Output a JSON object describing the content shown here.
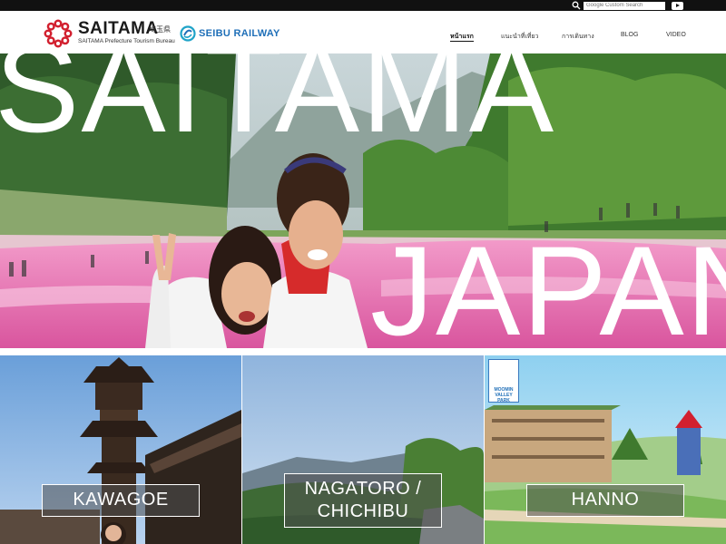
{
  "utility": {
    "search_placeholder": "Google Custom Search",
    "icons": [
      "search-icon",
      "youtube-icon"
    ]
  },
  "header": {
    "brand_name": "SAITAMA",
    "brand_jp": "埼玉県",
    "brand_sub": "SAITAMA Prefecture Tourism Bureau",
    "partner_name": "SEIBU RAILWAY",
    "colors": {
      "logo_red": "#d2202f",
      "partner_blue": "#1f6fb8"
    }
  },
  "nav": {
    "items": [
      {
        "label": "หน้าแรก",
        "active": true
      },
      {
        "label": "แนะนำที่เที่ยว",
        "active": false
      },
      {
        "label": "การเดินทาง",
        "active": false
      },
      {
        "label": "BLOG",
        "active": false
      },
      {
        "label": "VIDEO",
        "active": false
      }
    ]
  },
  "hero": {
    "word_top": "SAITAMA",
    "word_bottom": "JAPAN"
  },
  "cards": [
    {
      "label": "KAWAGOE"
    },
    {
      "label_line1": "NAGATORO /",
      "label_line2": "CHICHIBU"
    },
    {
      "label": "HANNO",
      "badge_line1": "MOOMIN",
      "badge_line2": "VALLEY",
      "badge_line3": "PARK"
    }
  ]
}
